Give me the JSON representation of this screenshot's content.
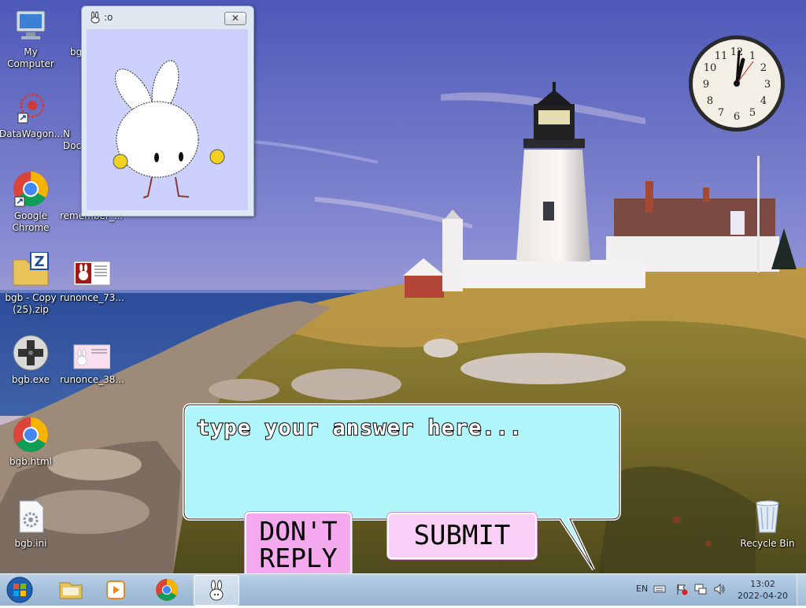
{
  "desktop": {
    "icons": [
      {
        "label": "My Computer",
        "icon": "computer-icon"
      },
      {
        "label": "bg",
        "icon": "file-icon"
      },
      {
        "label": "DataWagon...",
        "icon": "datawagon-icon"
      },
      {
        "label": "N\nDoc",
        "icon": "document-icon"
      },
      {
        "label": "Google\nChrome",
        "icon": "chrome-icon"
      },
      {
        "label": "remember_...",
        "icon": "folder-icon"
      },
      {
        "label": "bgb - Copy\n(25).zip",
        "icon": "zip-icon"
      },
      {
        "label": "runonce_73...",
        "icon": "image-thumbnail-icon"
      },
      {
        "label": "bgb.exe",
        "icon": "gamepad-icon"
      },
      {
        "label": "runonce_38...",
        "icon": "image-thumbnail-icon"
      },
      {
        "label": "bgb.html",
        "icon": "chrome-icon"
      },
      {
        "label": "bgb.ini",
        "icon": "config-file-icon"
      },
      {
        "label": "Recycle Bin",
        "icon": "recycle-bin-icon"
      }
    ]
  },
  "bunny_window": {
    "title": ":o",
    "close_label": "✕"
  },
  "dialog": {
    "answer_placeholder": "type your answer here...",
    "dont_reply_label": "DON'T\nREPLY",
    "submit_label": "SUBMIT",
    "bubble_color": "#b0f5fa",
    "button_color": "#f4a9ee"
  },
  "taskbar": {
    "language": "EN",
    "time": "13:02",
    "date": "2022-04-20",
    "pinned": [
      "windows-explorer-icon",
      "media-player-icon",
      "chrome-icon",
      "bunny-app-icon"
    ]
  }
}
